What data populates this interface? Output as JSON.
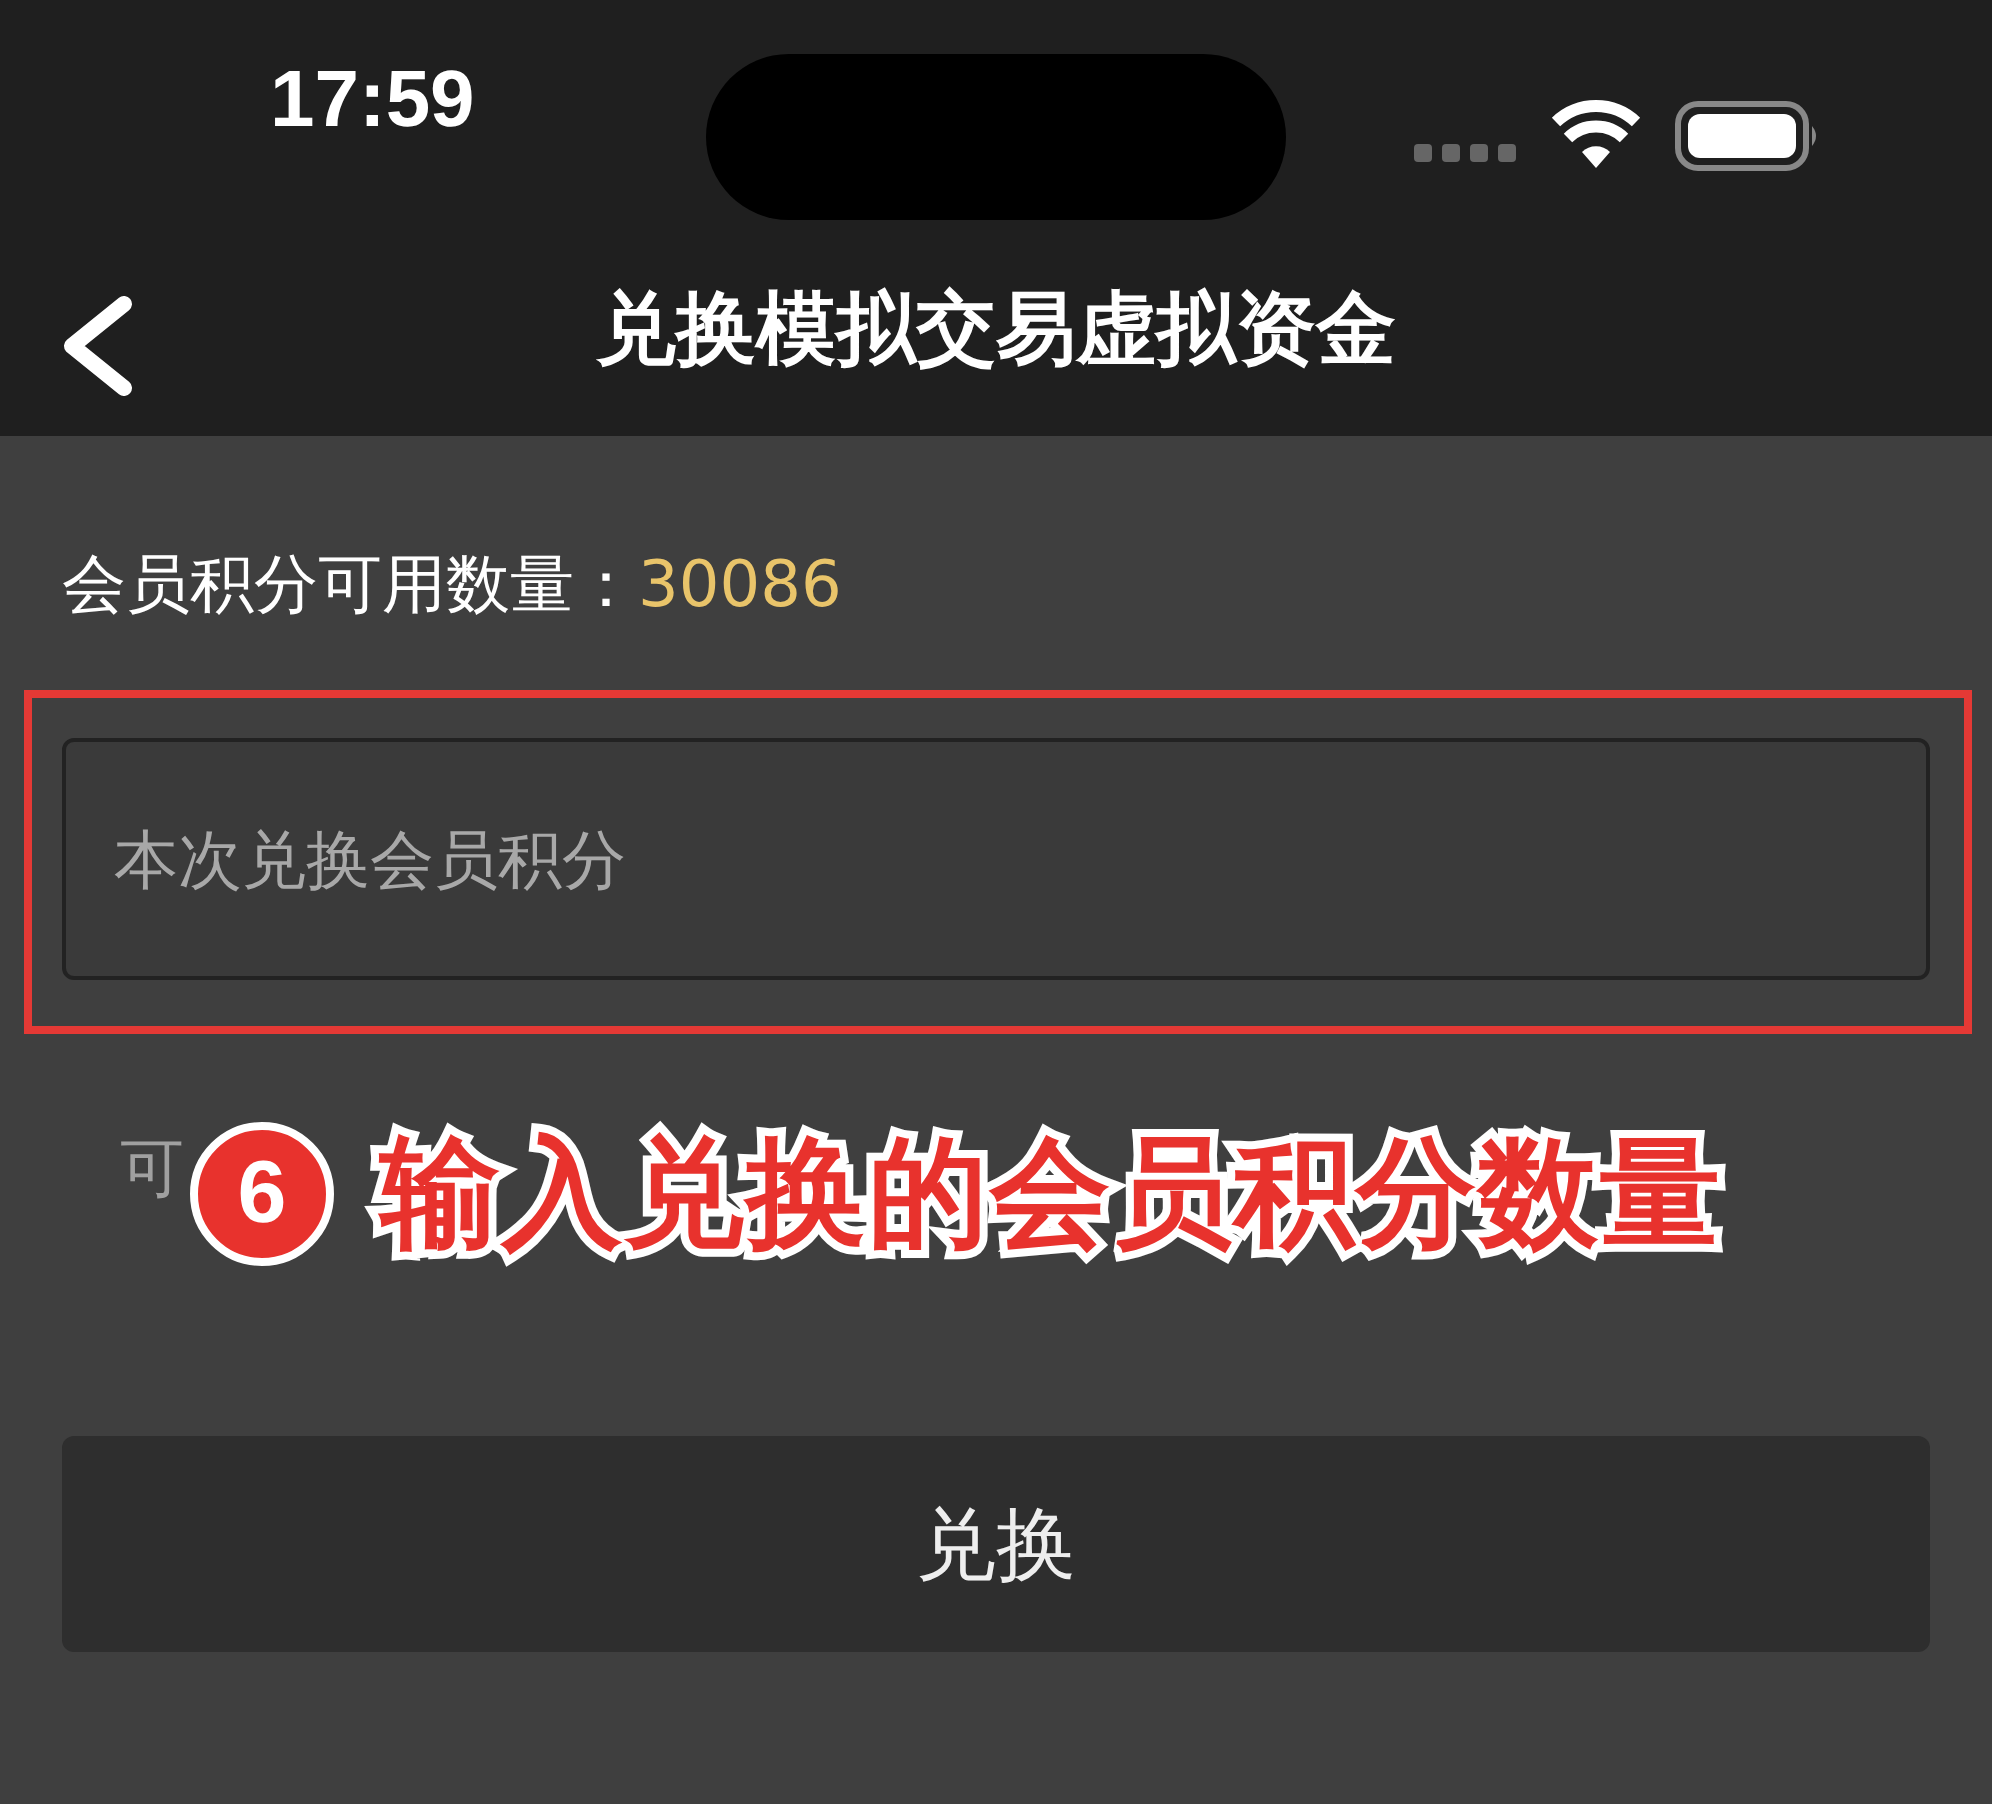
{
  "status_bar": {
    "time": "17:59"
  },
  "nav": {
    "title": "兑换模拟交易虚拟资金"
  },
  "member_points": {
    "label": "会员积分可用数量：",
    "value": "30086"
  },
  "points_field": {
    "placeholder": "本次兑换会员积分"
  },
  "exchange_hint": "可",
  "exchange_button": {
    "label": "兑换"
  },
  "annotation": {
    "step": "6",
    "text": "输入兑换的会员积分数量"
  }
}
